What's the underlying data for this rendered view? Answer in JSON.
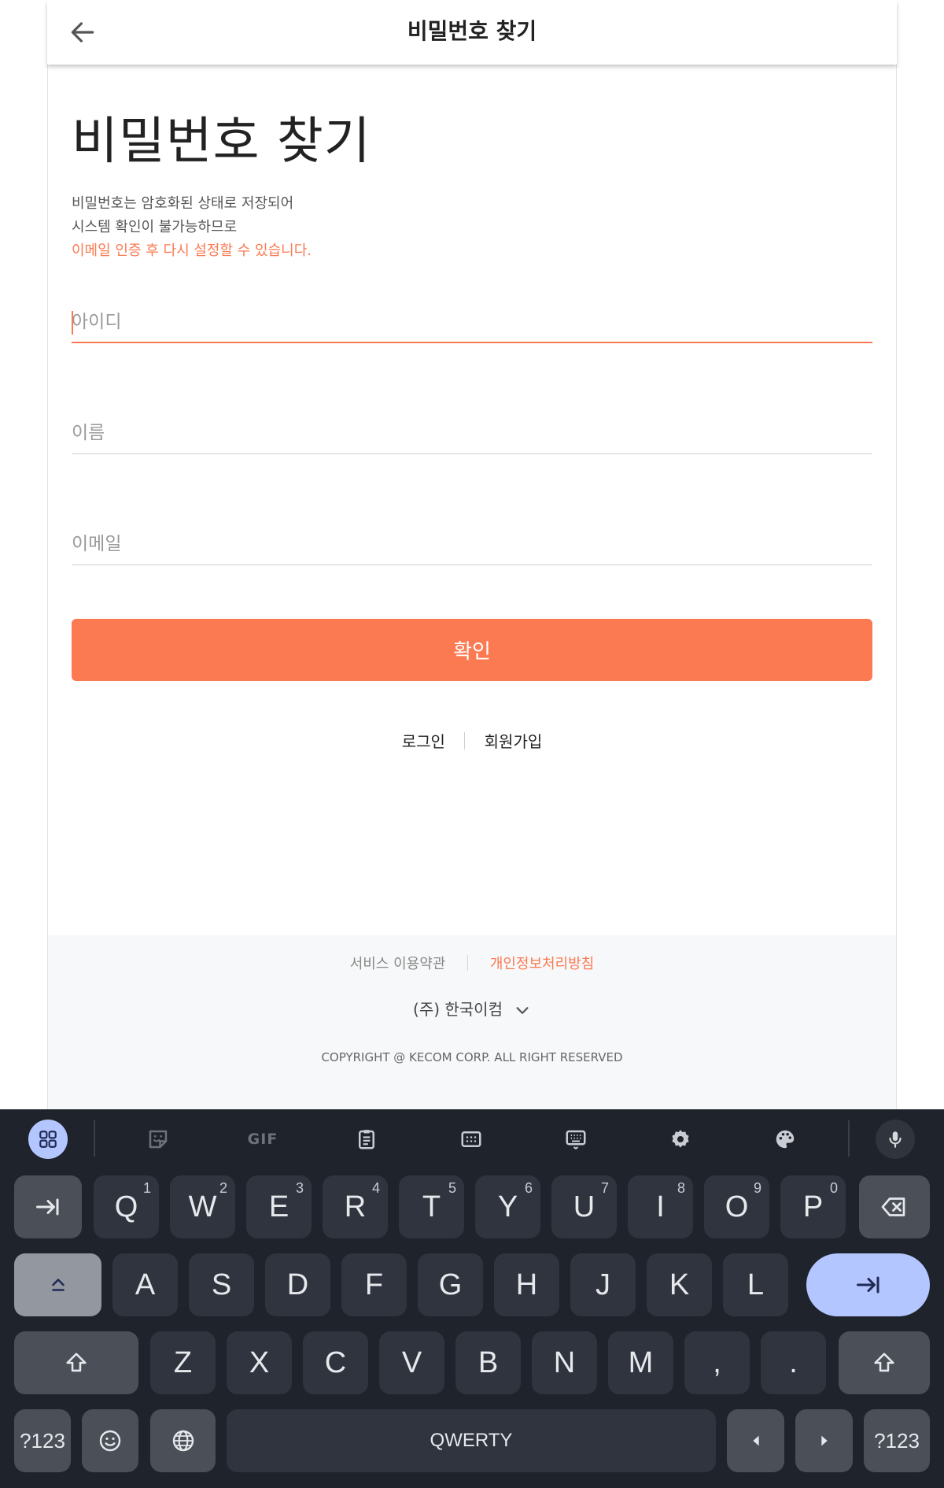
{
  "header": {
    "title": "비밀번호 찾기",
    "back_icon": "arrow-left-icon"
  },
  "main": {
    "heading": "비밀번호 찾기",
    "desc_line1": "비밀번호는 암호화된 상태로 저장되어",
    "desc_line2": "시스템 확인이 불가능하므로",
    "desc_highlight": "이메일 인증 후 다시 설정할 수 있습니다.",
    "fields": {
      "id_placeholder": "아이디",
      "name_placeholder": "이름",
      "email_placeholder": "이메일"
    },
    "submit_label": "확인",
    "login_link": "로그인",
    "signup_link": "회원가입"
  },
  "footer": {
    "terms": "서비스 이용약관",
    "privacy": "개인정보처리방침",
    "company": "(주) 한국이컴",
    "copyright": "COPYRIGHT @ KECOM CORP. ALL RIGHT RESERVED"
  },
  "keyboard": {
    "row1": [
      {
        "label": "Q",
        "hint": "1"
      },
      {
        "label": "W",
        "hint": "2"
      },
      {
        "label": "E",
        "hint": "3"
      },
      {
        "label": "R",
        "hint": "4"
      },
      {
        "label": "T",
        "hint": "5"
      },
      {
        "label": "Y",
        "hint": "6"
      },
      {
        "label": "U",
        "hint": "7"
      },
      {
        "label": "I",
        "hint": "8"
      },
      {
        "label": "O",
        "hint": "9"
      },
      {
        "label": "P",
        "hint": "0"
      }
    ],
    "row2": [
      "A",
      "S",
      "D",
      "F",
      "G",
      "H",
      "J",
      "K",
      "L"
    ],
    "row3": [
      "Z",
      "X",
      "C",
      "V",
      "B",
      "N",
      "M",
      ",",
      "."
    ],
    "symbols_label": "?123",
    "space_label": "QWERTY",
    "accent": "#b4c6ff"
  },
  "colors": {
    "brand": "#fc7a52",
    "keyboard_bg": "#1f232b"
  }
}
